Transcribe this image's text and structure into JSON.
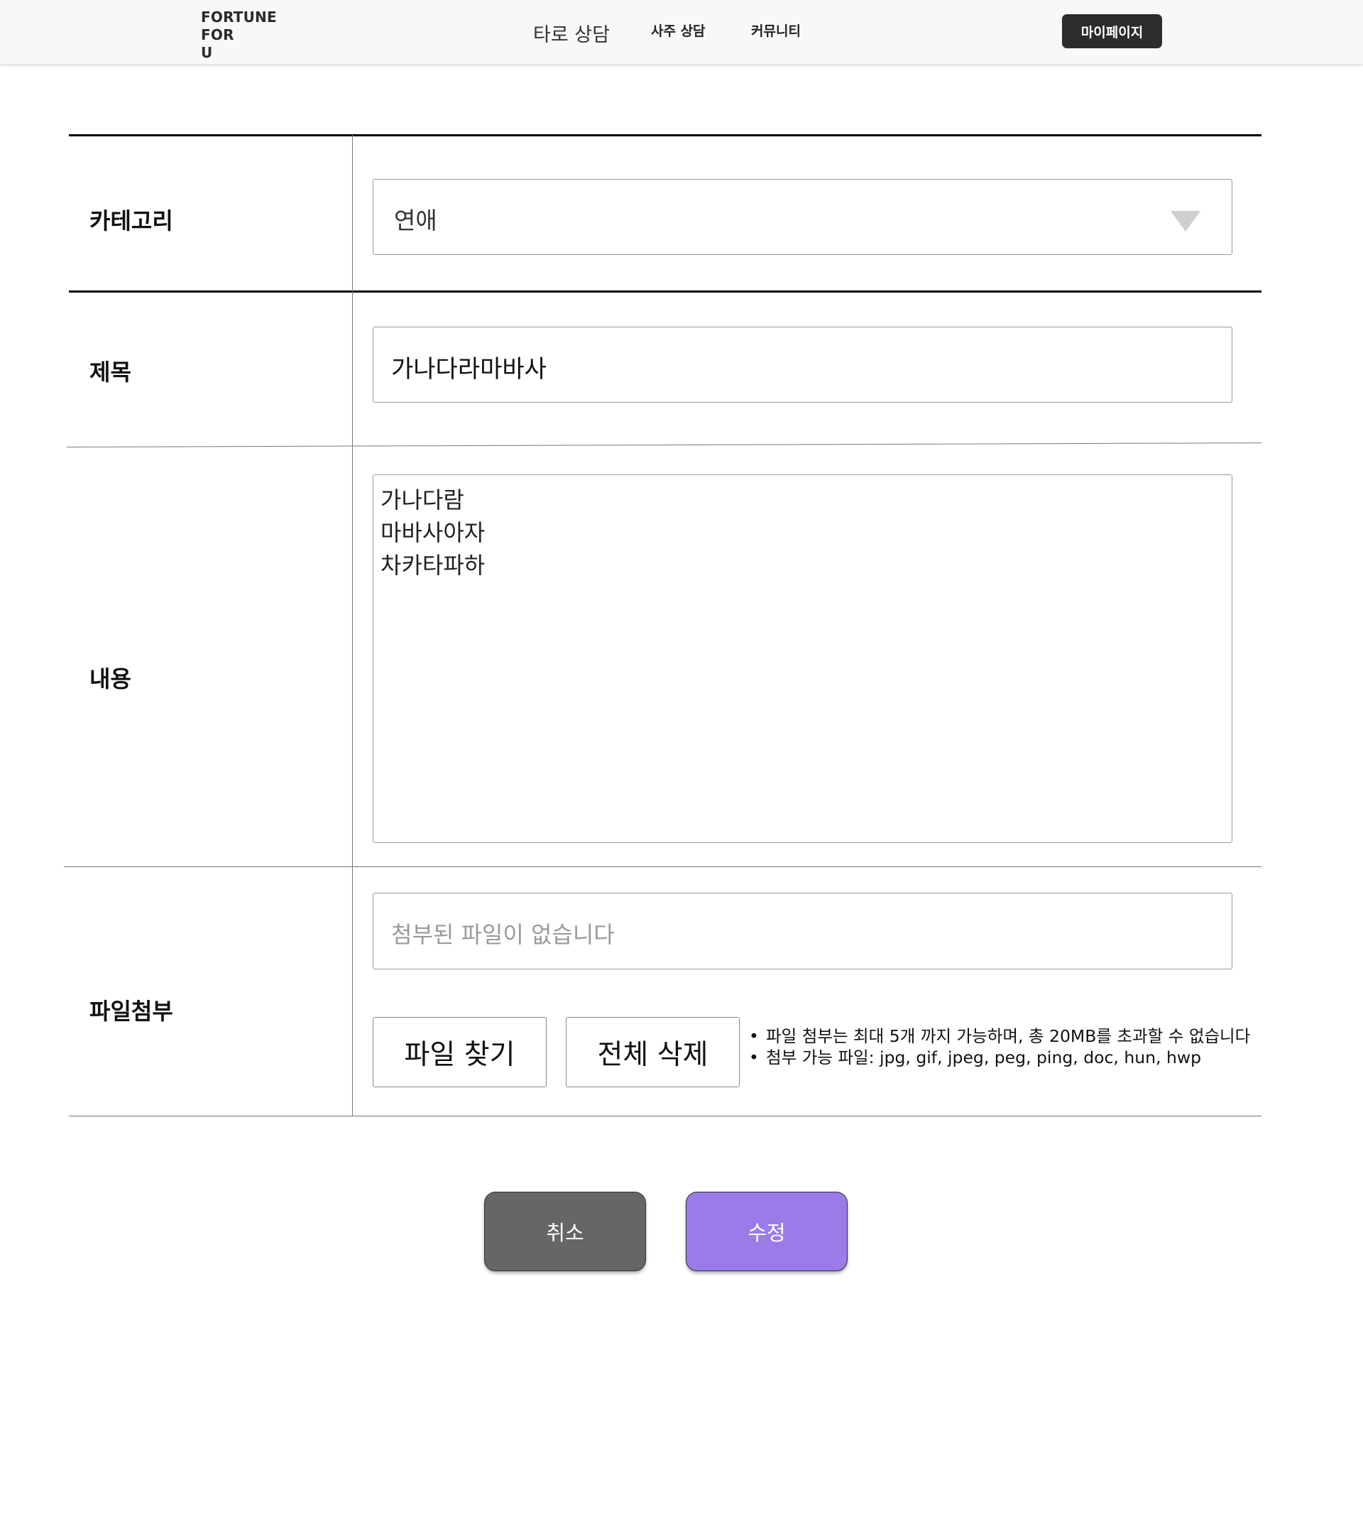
{
  "header": {
    "logo_lines": [
      "FORTUNE",
      "FOR",
      "U"
    ],
    "nav": {
      "tarot": "타로 상담",
      "saju": "사주 상담",
      "community": "커뮤니티"
    },
    "mypage_label": "마이페이지"
  },
  "form": {
    "category": {
      "label": "카테고리",
      "value": "연애"
    },
    "title": {
      "label": "제목",
      "value": "가나다라마바사"
    },
    "content": {
      "label": "내용",
      "lines": [
        "가나다람",
        "마바사아자",
        "차카타파하"
      ]
    },
    "attachment": {
      "label": "파일첨부",
      "placeholder": "첨부된 파일이 없습니다",
      "find_label": "파일 찾기",
      "delete_all_label": "전체 삭제",
      "notes": [
        "파일 첨부는 최대 5개 까지 가능하며, 총 20MB를 초과할 수 없습니다",
        "첨부 가능 파일: jpg, gif, jpeg, peg, ping, doc, hun, hwp"
      ]
    }
  },
  "actions": {
    "cancel_label": "취소",
    "submit_label": "수정"
  },
  "colors": {
    "mypage_bg": "#2c2c2c",
    "cancel_bg": "#666666",
    "submit_bg": "#9b7be8"
  }
}
